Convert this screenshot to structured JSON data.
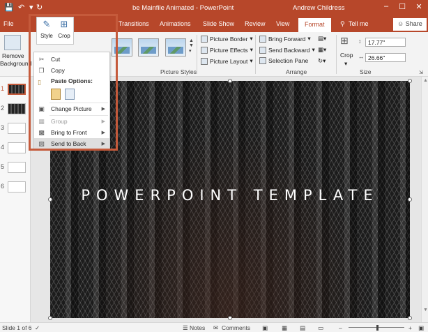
{
  "titlebar": {
    "doc_title": "be Mainfile Animated  -  PowerPoint",
    "user": "Andrew Childress",
    "minimize": "–",
    "restore": "☐",
    "close": "✕"
  },
  "tabs": {
    "file": "File",
    "transitions": "Transitions",
    "animations": "Animations",
    "slideshow": "Slide Show",
    "review": "Review",
    "view": "View",
    "format": "Format",
    "tellme": "Tell me",
    "share": "Share"
  },
  "ribbon": {
    "remove_bg": "Remove",
    "remove_bg2": "Background",
    "picture_border": "Picture Border",
    "picture_effects": "Picture Effects",
    "picture_layout": "Picture Layout",
    "picture_styles": "Picture Styles",
    "bring_forward": "Bring Forward",
    "send_backward": "Send Backward",
    "selection_pane": "Selection Pane",
    "arrange": "Arrange",
    "crop": "Crop",
    "height": "17.77\"",
    "width": "26.66\"",
    "size": "Size"
  },
  "mini_toolbar": {
    "style": "Style",
    "crop": "Crop"
  },
  "context_menu": {
    "cut": "Cut",
    "copy": "Copy",
    "paste_options": "Paste Options:",
    "change_picture": "Change Picture",
    "group": "Group",
    "bring_to_front": "Bring to Front",
    "send_to_back": "Send to Back"
  },
  "thumbs": [
    "1",
    "2",
    "3",
    "4",
    "5",
    "6"
  ],
  "slide": {
    "title": "POWERPOINT TEMPLATE"
  },
  "statusbar": {
    "slide_count": "Slide 1 of 6",
    "notes": "Notes",
    "comments": "Comments"
  },
  "colors": {
    "accent": "#b7472a",
    "highlight": "#c55a3b"
  }
}
